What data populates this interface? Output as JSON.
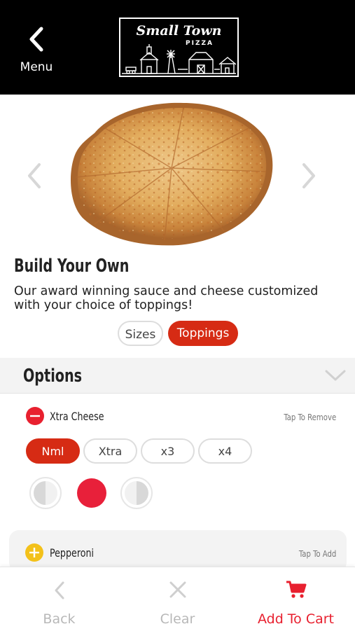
{
  "header": {
    "back_label": "Menu",
    "logo": {
      "title": "Small Town",
      "subtitle": "PIZZA"
    }
  },
  "product": {
    "image_icon": "cheese-pizza-photo",
    "title": "Build Your Own",
    "description": "Our award winning sauce and cheese customized with your choice of toppings!"
  },
  "tabs": [
    {
      "label": "Sizes",
      "selected": false
    },
    {
      "label": "Toppings",
      "selected": true
    }
  ],
  "options": {
    "title": "Options",
    "toppings": [
      {
        "name": "Xtra Cheese",
        "hint": "Tap To Remove",
        "added": true,
        "amounts": [
          "Nml",
          "Xtra",
          "x3",
          "x4"
        ],
        "selected_amount": "Nml",
        "portions": [
          "left-half",
          "whole",
          "right-half"
        ],
        "selected_portion": "whole"
      },
      {
        "name": "Pepperoni",
        "hint": "Tap To Add",
        "added": false
      }
    ]
  },
  "bottom_nav": {
    "back": "Back",
    "clear": "Clear",
    "add_to_cart": "Add To Cart"
  },
  "colors": {
    "accent": "#d62b14",
    "remove_red": "#e8202f",
    "add_yellow": "#f3c11a",
    "header_bg": "#000000"
  }
}
